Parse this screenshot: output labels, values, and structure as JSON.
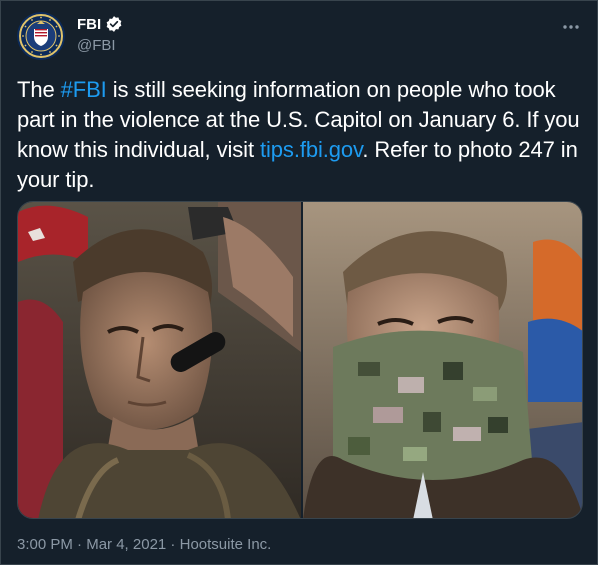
{
  "tweet": {
    "author_name": "FBI",
    "author_handle": "@FBI",
    "text_before_hashtag": "The ",
    "hashtag": "#FBI",
    "text_middle": " is still seeking information on people who took part in the violence at the U.S. Capitol on January 6. If you know this individual, visit ",
    "link": "tips.fbi.gov",
    "text_after_link": ". Refer to photo 247 in your tip.",
    "time": "3:00 PM",
    "separator1": " · ",
    "date": "Mar 4, 2021",
    "separator2": " · ",
    "source": "Hootsuite Inc."
  },
  "icons": {
    "avatar": "fbi-seal-icon",
    "verified": "verified-badge-icon",
    "more": "more-options-icon"
  },
  "colors": {
    "background": "#15202b",
    "text": "#ffffff",
    "secondary": "#8b98a5",
    "link": "#1d9bf0"
  }
}
